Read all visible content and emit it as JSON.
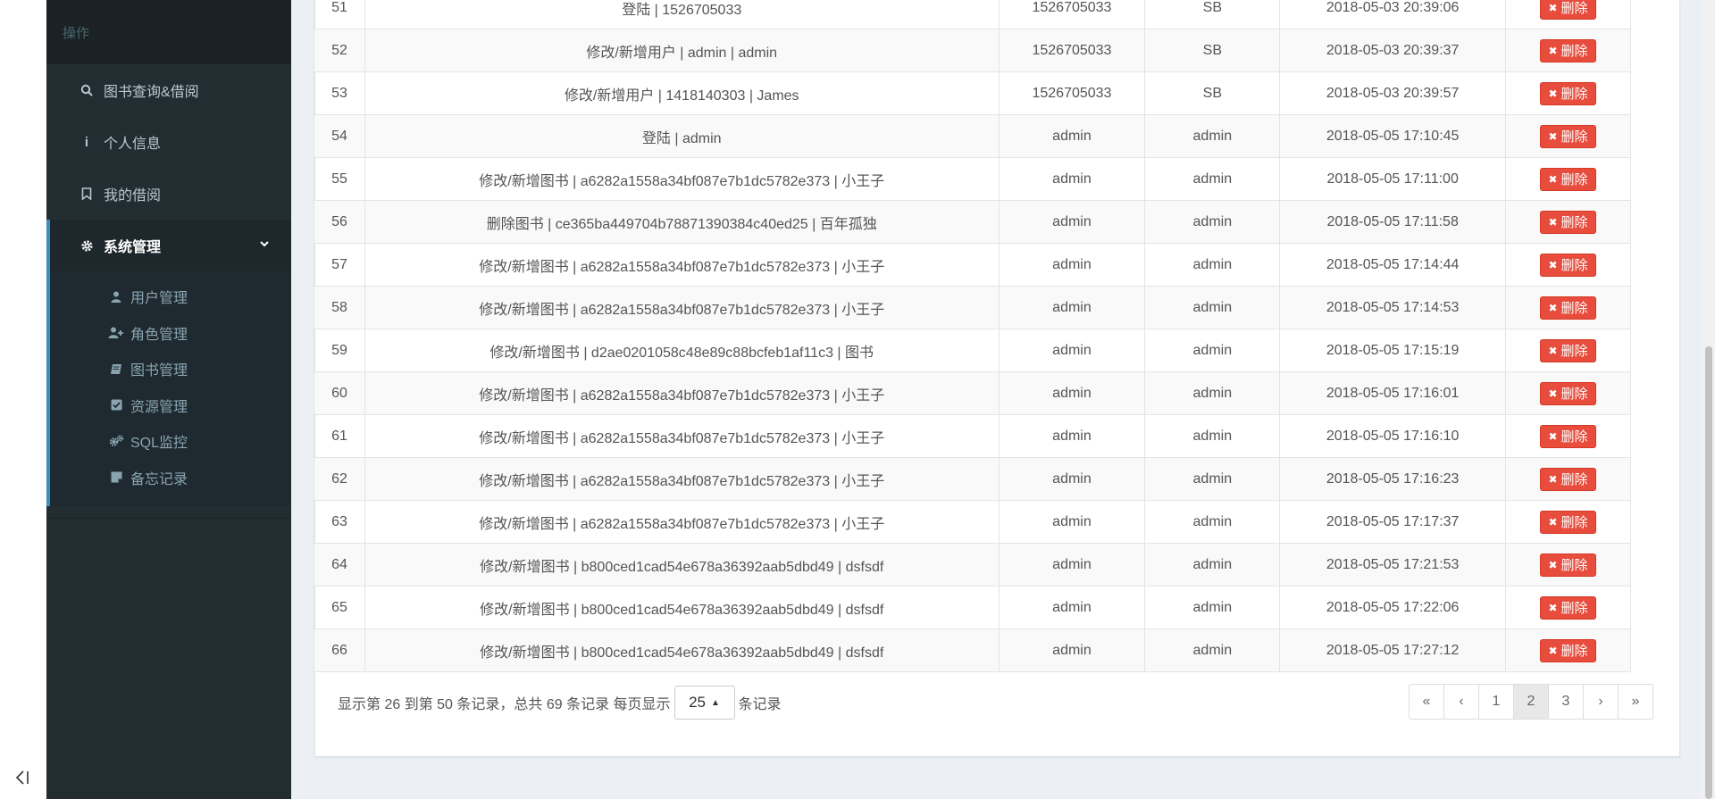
{
  "sidebar": {
    "header": "操作",
    "items": [
      {
        "label": "图书查询&借阅",
        "icon": "search-icon"
      },
      {
        "label": "个人信息",
        "icon": "info-icon"
      },
      {
        "label": "我的借阅",
        "icon": "bookmark-icon"
      }
    ],
    "active": {
      "label": "系统管理",
      "icon": "gear-icon"
    },
    "sub_items": [
      {
        "label": "用户管理",
        "icon": "user-icon"
      },
      {
        "label": "角色管理",
        "icon": "user-plus-icon"
      },
      {
        "label": "图书管理",
        "icon": "book-icon"
      },
      {
        "label": "资源管理",
        "icon": "check-square-icon"
      },
      {
        "label": "SQL监控",
        "icon": "cogs-icon"
      },
      {
        "label": "备忘记录",
        "icon": "sticky-note-icon"
      }
    ]
  },
  "table": {
    "delete_label": "删除",
    "partial_row": {
      "id": "51",
      "desc": "登陆 | 1526705033",
      "account": "1526705033",
      "name": "SB",
      "time": "2018-05-03 20:39:06"
    },
    "rows": [
      {
        "id": "52",
        "desc": "修改/新增用户 | admin | admin",
        "account": "1526705033",
        "name": "SB",
        "time": "2018-05-03 20:39:37"
      },
      {
        "id": "53",
        "desc": "修改/新增用户 | 1418140303 | James",
        "account": "1526705033",
        "name": "SB",
        "time": "2018-05-03 20:39:57"
      },
      {
        "id": "54",
        "desc": "登陆 | admin",
        "account": "admin",
        "name": "admin",
        "time": "2018-05-05 17:10:45"
      },
      {
        "id": "55",
        "desc": "修改/新增图书 | a6282a1558a34bf087e7b1dc5782e373 | 小王子",
        "account": "admin",
        "name": "admin",
        "time": "2018-05-05 17:11:00"
      },
      {
        "id": "56",
        "desc": "删除图书 | ce365ba449704b78871390384c40ed25 | 百年孤独",
        "account": "admin",
        "name": "admin",
        "time": "2018-05-05 17:11:58"
      },
      {
        "id": "57",
        "desc": "修改/新增图书 | a6282a1558a34bf087e7b1dc5782e373 | 小王子",
        "account": "admin",
        "name": "admin",
        "time": "2018-05-05 17:14:44"
      },
      {
        "id": "58",
        "desc": "修改/新增图书 | a6282a1558a34bf087e7b1dc5782e373 | 小王子",
        "account": "admin",
        "name": "admin",
        "time": "2018-05-05 17:14:53"
      },
      {
        "id": "59",
        "desc": "修改/新增图书 | d2ae0201058c48e89c88bcfeb1af11c3 | 图书",
        "account": "admin",
        "name": "admin",
        "time": "2018-05-05 17:15:19"
      },
      {
        "id": "60",
        "desc": "修改/新增图书 | a6282a1558a34bf087e7b1dc5782e373 | 小王子",
        "account": "admin",
        "name": "admin",
        "time": "2018-05-05 17:16:01"
      },
      {
        "id": "61",
        "desc": "修改/新增图书 | a6282a1558a34bf087e7b1dc5782e373 | 小王子",
        "account": "admin",
        "name": "admin",
        "time": "2018-05-05 17:16:10"
      },
      {
        "id": "62",
        "desc": "修改/新增图书 | a6282a1558a34bf087e7b1dc5782e373 | 小王子",
        "account": "admin",
        "name": "admin",
        "time": "2018-05-05 17:16:23"
      },
      {
        "id": "63",
        "desc": "修改/新增图书 | a6282a1558a34bf087e7b1dc5782e373 | 小王子",
        "account": "admin",
        "name": "admin",
        "time": "2018-05-05 17:17:37"
      },
      {
        "id": "64",
        "desc": "修改/新增图书 | b800ced1cad54e678a36392aab5dbd49 | dsfsdf",
        "account": "admin",
        "name": "admin",
        "time": "2018-05-05 17:21:53"
      },
      {
        "id": "65",
        "desc": "修改/新增图书 | b800ced1cad54e678a36392aab5dbd49 | dsfsdf",
        "account": "admin",
        "name": "admin",
        "time": "2018-05-05 17:22:06"
      },
      {
        "id": "66",
        "desc": "修改/新增图书 | b800ced1cad54e678a36392aab5dbd49 | dsfsdf",
        "account": "admin",
        "name": "admin",
        "time": "2018-05-05 17:27:12"
      }
    ]
  },
  "pager": {
    "info_prefix": "显示第 26 到第 50 条记录，总共 69 条记录 每页显示",
    "page_size": "25",
    "info_suffix": "条记录",
    "first": "«",
    "prev": "‹",
    "pages": [
      "1",
      "2",
      "3"
    ],
    "active_page": "2",
    "next": "›",
    "last": "»"
  },
  "colors": {
    "sidebar_bg": "#222d32",
    "accent": "#3c8dbc",
    "danger": "#e74c3c"
  }
}
